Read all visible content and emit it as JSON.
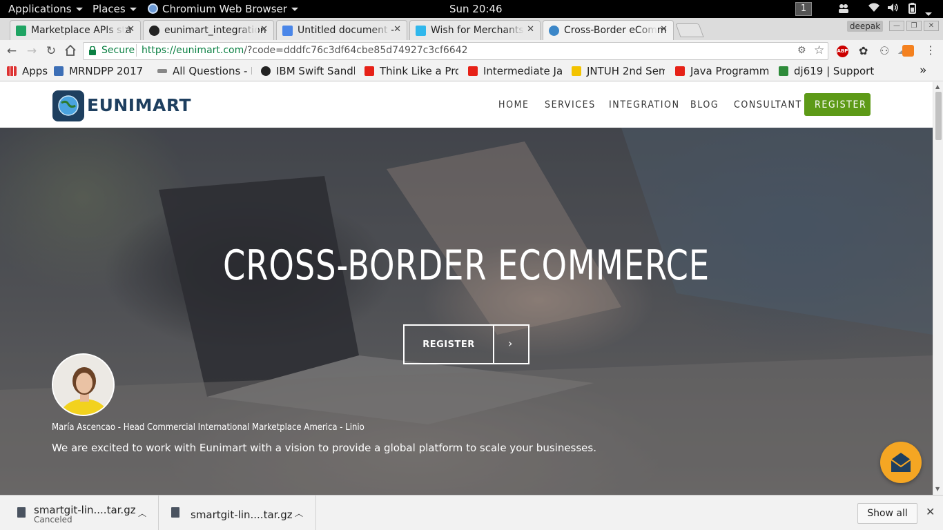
{
  "topbar": {
    "applications": "Applications",
    "places": "Places",
    "app_name": "Chromium Web Browser",
    "clock": "Sun 20:46",
    "workspace": "1"
  },
  "tabs": [
    {
      "title": "Marketplace APIs sta",
      "icon": "sheets-icon"
    },
    {
      "title": "eunimart_integration",
      "icon": "github-icon"
    },
    {
      "title": "Untitled document -",
      "icon": "docs-icon"
    },
    {
      "title": "Wish for Merchants",
      "icon": "wish-icon"
    },
    {
      "title": "Cross-Border eComm",
      "icon": "eunimart-icon"
    }
  ],
  "profile": "deepak",
  "omnibox": {
    "secure_label": "Secure",
    "url_host": "https://eunimart.com",
    "url_path": "/?code=dddfc76c3df64cbe85d74927c3cf6642"
  },
  "bookmarks": [
    {
      "label": "Apps"
    },
    {
      "label": "MRNDPP 2017 ("
    },
    {
      "label": "All Questions - M"
    },
    {
      "label": "IBM Swift Sandbo"
    },
    {
      "label": "Think Like a Progr"
    },
    {
      "label": "Intermediate Java"
    },
    {
      "label": "JNTUH 2nd Sem"
    },
    {
      "label": "Java Programming"
    },
    {
      "label": "dj619 | Support C"
    }
  ],
  "site": {
    "logo_text": "EUNIMART",
    "nav": [
      "HOME",
      "SERVICES",
      "INTEGRATION",
      "BLOG",
      "CONSULTANT"
    ],
    "register_nav": "REGISTER",
    "accent_color": "#5d9a17",
    "hero_title": "CROSS-BORDER ECOMMERCE",
    "hero_button": "REGISTER",
    "quote_author": "María Ascencao  -  Head Commercial International Marketplace America  -  Linio",
    "quote_text": "We are excited to work with Eunimart with a vision to provide a global platform to scale your businesses.",
    "chat_color": "#f5a623"
  },
  "downloads": [
    {
      "name": "smartgit-lin....tar.gz",
      "status": "Canceled"
    },
    {
      "name": "smartgit-lin....tar.gz",
      "status": ""
    }
  ],
  "show_all": "Show all"
}
